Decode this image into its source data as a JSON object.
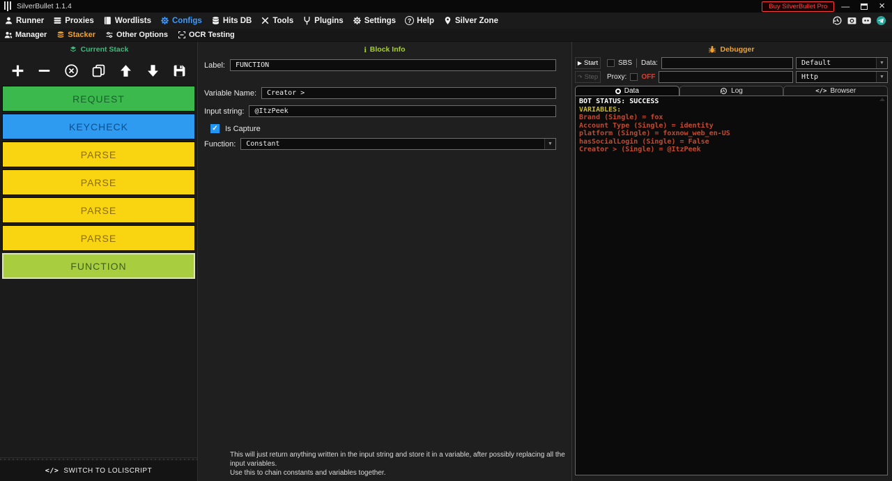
{
  "window": {
    "app_title": "SilverBullet 1.1.4",
    "buy_pro_label": "Buy SilverBullet Pro"
  },
  "menubar": {
    "items": [
      {
        "label": "Runner"
      },
      {
        "label": "Proxies"
      },
      {
        "label": "Wordlists"
      },
      {
        "label": "Configs"
      },
      {
        "label": "Hits DB"
      },
      {
        "label": "Tools"
      },
      {
        "label": "Plugins"
      },
      {
        "label": "Settings"
      },
      {
        "label": "Help"
      },
      {
        "label": "Silver Zone"
      }
    ],
    "active_item": "Configs"
  },
  "submenu": {
    "items": [
      {
        "label": "Manager"
      },
      {
        "label": "Stacker"
      },
      {
        "label": "Other Options"
      },
      {
        "label": "OCR Testing"
      }
    ],
    "active_item": "Stacker"
  },
  "stack_panel": {
    "header": "Current Stack",
    "blocks": [
      {
        "label": "REQUEST",
        "bg": "#3CB94C",
        "fg": "#14632a"
      },
      {
        "label": "KEYCHECK",
        "bg": "#2E9BF0",
        "fg": "#0a4d8f"
      },
      {
        "label": "PARSE",
        "bg": "#F9D410",
        "fg": "#8a6d00"
      },
      {
        "label": "PARSE",
        "bg": "#F9D410",
        "fg": "#8a6d00"
      },
      {
        "label": "PARSE",
        "bg": "#F9D410",
        "fg": "#8a6d00"
      },
      {
        "label": "PARSE",
        "bg": "#F9D410",
        "fg": "#8a6d00"
      },
      {
        "label": "FUNCTION",
        "bg": "#A8CE3F",
        "fg": "#3f5e14",
        "selected": true
      }
    ],
    "switch_button_label": "SWITCH TO LOLISCRIPT"
  },
  "block_info": {
    "header": "Block Info",
    "label_field": {
      "label": "Label:",
      "value": "FUNCTION"
    },
    "variable_name_field": {
      "label": "Variable Name:",
      "value": "Creator >"
    },
    "input_string_field": {
      "label": "Input string:",
      "value": "@ItzPeek"
    },
    "is_capture": {
      "label": "Is Capture",
      "checked": true
    },
    "function_field": {
      "label": "Function:",
      "value": "Constant"
    },
    "description_line1": "This will just return anything written in the input string and store it in a variable, after possibly replacing all the input variables.",
    "description_line2": "Use this to chain constants and variables together."
  },
  "debugger": {
    "header": "Debugger",
    "start_label": "Start",
    "step_label": "Step",
    "sbs_label": "SBS",
    "data_label": "Data:",
    "data_value": "",
    "proxy_label": "Proxy:",
    "proxy_state": "OFF",
    "proxy_value": "",
    "wordlist_type": "Default",
    "proxy_type": "Http",
    "tabs": [
      {
        "label": "Data"
      },
      {
        "label": "Log"
      },
      {
        "label": "Browser"
      }
    ],
    "active_tab": "Data",
    "log": {
      "status_line": "BOT STATUS: SUCCESS",
      "variables_header": "VARIABLES:",
      "variables": [
        "Brand (Single) = fox",
        "Account Type (Single) = identity",
        "platform (Single) = foxnow_web_en-US",
        "hasSocialLogin (Single) = False",
        "Creator >  (Single) = @ItzPeek"
      ]
    }
  },
  "icons": {
    "play_glyph": "▶",
    "step_glyph": "↷",
    "dropdown_glyph": "▼",
    "check_glyph": "✓",
    "code_glyph": "</>",
    "help_glyph": "?",
    "info_glyph": "i",
    "minimize_glyph": "—",
    "close_glyph": "×"
  },
  "colors": {
    "configs_active": "#3D9BFF",
    "stacker_active": "#F0A230",
    "current_stack_green": "#3CBC7C",
    "block_info_green": "#A6D02C",
    "debugger_orange": "#F0A230",
    "off_red": "#E23B2E",
    "variables_yellow": "#C9B92F",
    "variable_text_red": "#C04B32",
    "buy_pro_red": "#FF4343",
    "telegram_teal": "#26A69A",
    "capture_check_blue": "#2196F3"
  }
}
